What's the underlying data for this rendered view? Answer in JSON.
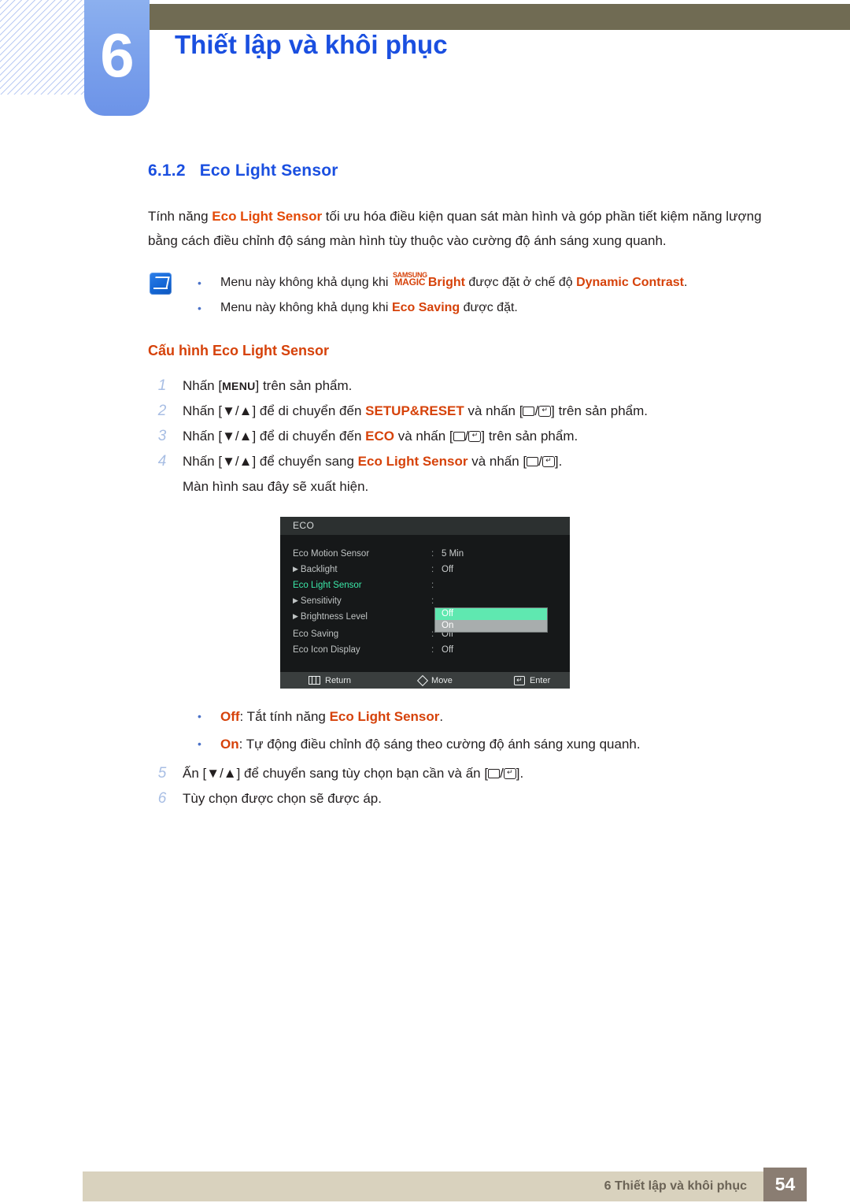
{
  "header": {
    "chapter_number": "6",
    "chapter_title": "Thiết lập và khôi phục"
  },
  "section": {
    "number": "6.1.2",
    "title": "Eco Light Sensor",
    "intro_part1": "Tính năng ",
    "intro_term": "Eco Light Sensor",
    "intro_part2": " tối ưu hóa điều kiện quan sát màn hình và góp phần tiết kiệm năng lượng bằng cách điều chỉnh độ sáng màn hình tùy thuộc vào cường độ ánh sáng xung quanh."
  },
  "note": {
    "icon": "note-pen-icon",
    "bullet1_pre": "Menu này không khả dụng khi ",
    "bullet1_magic_top": "SAMSUNG",
    "bullet1_magic_bottom": "MAGIC",
    "bullet1_bright": "Bright",
    "bullet1_mid": " được đặt ở chế độ ",
    "bullet1_mode": "Dynamic Contrast",
    "bullet1_end": ".",
    "bullet2_pre": "Menu này không khả dụng khi ",
    "bullet2_term": "Eco Saving",
    "bullet2_post": " được đặt."
  },
  "config": {
    "heading": "Cấu hình Eco Light Sensor",
    "steps": [
      {
        "num": "1",
        "pre": "Nhấn [",
        "key": "MENU",
        "post": "] trên sản phẩm.",
        "type": "menu"
      },
      {
        "num": "2",
        "pre": "Nhấn [▼/▲] để di chuyển đến ",
        "term": "SETUP&RESET",
        "mid": " và nhấn [",
        "post": "] trên sản phẩm.",
        "type": "nav"
      },
      {
        "num": "3",
        "pre": "Nhấn [▼/▲] để di chuyển đến ",
        "term": "ECO",
        "mid": " và nhấn [",
        "post": "] trên sản phẩm.",
        "type": "nav"
      },
      {
        "num": "4",
        "pre": "Nhấn [▼/▲] để chuyển sang ",
        "term": "Eco Light Sensor",
        "mid": " và nhấn [",
        "post": "].",
        "type": "nav"
      }
    ],
    "after_step4": "Màn hình sau đây sẽ xuất hiện.",
    "steps_after": [
      {
        "num": "5",
        "pre": "Ấn [▼/▲] để chuyển sang tùy chọn bạn cần và ấn [",
        "post": "].",
        "type": "nav"
      },
      {
        "num": "6",
        "pre": "Tùy chọn được chọn sẽ được áp.",
        "type": "plain"
      }
    ]
  },
  "osd": {
    "title": "ECO",
    "rows": [
      {
        "label": "Eco Motion Sensor",
        "arrow": false,
        "selected": false,
        "colon": ":",
        "value": "5 Min"
      },
      {
        "label": "Backlight",
        "arrow": true,
        "selected": false,
        "colon": ":",
        "value": "Off"
      },
      {
        "label": "Eco Light Sensor",
        "arrow": false,
        "selected": true,
        "colon": ":",
        "value": ""
      },
      {
        "label": "Sensitivity",
        "arrow": true,
        "selected": false,
        "colon": ":",
        "value": ""
      },
      {
        "label": "Brightness Level",
        "arrow": true,
        "selected": false,
        "colon": "",
        "value": ""
      },
      {
        "label": "Eco Saving",
        "arrow": false,
        "selected": false,
        "colon": ":",
        "value": "Off"
      },
      {
        "label": "Eco Icon Display",
        "arrow": false,
        "selected": false,
        "colon": ":",
        "value": "Off"
      }
    ],
    "dropdown": {
      "option_highlighted": "Off",
      "option_other": "On",
      "highlight_color": "#5FE8B0",
      "other_color": "#A8ADAD"
    },
    "footer": {
      "return_label": "Return",
      "move_label": "Move",
      "enter_label": "Enter"
    }
  },
  "options": {
    "off_term": "Off",
    "off_pre": ": Tắt tính năng ",
    "off_term2": "Eco Light Sensor",
    "off_post": ".",
    "on_term": "On",
    "on_text": ": Tự động điều chỉnh độ sáng theo cường độ ánh sáng xung quanh."
  },
  "footer": {
    "text": "6 Thiết lập và khôi phục",
    "page": "54"
  }
}
